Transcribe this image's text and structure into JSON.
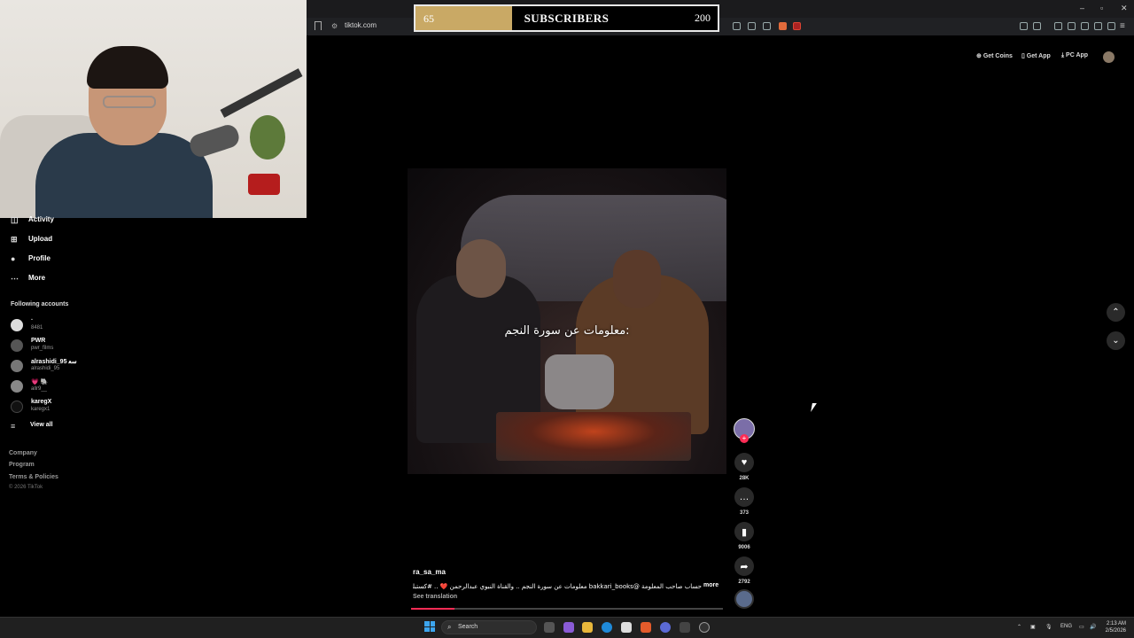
{
  "browser": {
    "url": "tiktok.com",
    "window_controls": [
      "–",
      "▫",
      "✕"
    ]
  },
  "subscriber_goal": {
    "start": "65",
    "title": "SUBSCRIBERS",
    "target": "200",
    "fill_color": "#c9a965",
    "progress": 0.32
  },
  "tiktok_header": {
    "get_coins": "Get Coins",
    "get_app": "Get App",
    "pc_app": "PC App"
  },
  "sidebar": {
    "items": [
      {
        "label": "Activity",
        "icon": "activity-icon"
      },
      {
        "label": "Upload",
        "icon": "upload-icon"
      },
      {
        "label": "Profile",
        "icon": "profile-icon"
      },
      {
        "label": "More",
        "icon": "more-icon"
      }
    ],
    "following_heading": "Following accounts",
    "accounts": [
      {
        "name": "·",
        "handle": "8481"
      },
      {
        "name": "PWR",
        "handle": "pwr_films"
      },
      {
        "name": "alrashidi_95 ﺳﻌ",
        "handle": "alrashidi_95"
      },
      {
        "name": "💗 🐘",
        "handle": "allr9__"
      },
      {
        "name": "karegX",
        "handle": "karegx1"
      }
    ],
    "view_all": "View all",
    "links": [
      "Company",
      "Program",
      "Terms & Policies"
    ],
    "copyright": "© 2026 TikTok"
  },
  "video": {
    "caption": "معلومات عن سورة النجم:",
    "username": "ra_sa_ma",
    "description": "حساب صاحب المعلومة @bakkari_books معلومات عن سورة النجم .. والقناة النبوي عبدالرحمن ❤️ .. #كستبلو...",
    "more": "more",
    "see_translation": "See translation",
    "progress": 0.14
  },
  "actions": {
    "likes": "28K",
    "comments": "373",
    "saves": "9006",
    "shares": "2792"
  },
  "taskbar": {
    "search_label": "Search",
    "language": "ENG",
    "time": "2:13 AM",
    "date": "2/5/2026"
  }
}
